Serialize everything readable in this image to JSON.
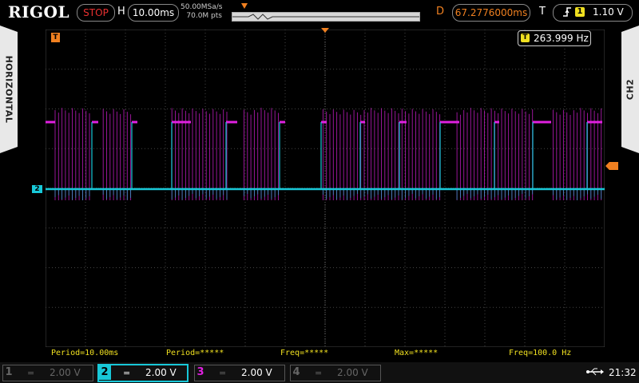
{
  "brand": "RIGOL",
  "run_state": "STOP",
  "horizontal": {
    "letter": "H",
    "timebase": "10.00ms",
    "sample_rate": "50.00MSa/s",
    "memory_depth": "70.0M pts"
  },
  "delay": {
    "letter": "D",
    "value": "67.2776000ms"
  },
  "trigger": {
    "letter": "T",
    "edge_icon": "rising-edge-icon",
    "source": "1",
    "level": "1.10 V"
  },
  "side_tabs": {
    "left": "HORIZONTAL",
    "right": "CH2"
  },
  "screen": {
    "freq_counter_icon": "T",
    "freq_counter": "263.999 Hz",
    "ch2_marker": "2",
    "trigger_pos_marker": "T"
  },
  "measurements": [
    "Period=10.00ms",
    "Period=*****",
    "Freq=*****",
    "Max=*****",
    "Freq=100.0 Hz"
  ],
  "channels": [
    {
      "num": "1",
      "coupling": "=",
      "volts": "2.00 V",
      "color": "#555555",
      "active": false
    },
    {
      "num": "2",
      "coupling": "=",
      "volts": "2.00 V",
      "color": "#18c8d8",
      "active": true
    },
    {
      "num": "3",
      "coupling": "=",
      "volts": "2.00 V",
      "color": "#e020e0",
      "active": false
    },
    {
      "num": "4",
      "coupling": "=",
      "volts": "2.00 V",
      "color": "#555555",
      "active": false
    }
  ],
  "status": {
    "usb_icon": "usb-icon",
    "time": "21:32"
  },
  "colors": {
    "ch2": "#18c8d8",
    "ch3": "#e020e0",
    "trigger": "#f08020",
    "measure": "#f0e020",
    "stop": "#e83030"
  }
}
